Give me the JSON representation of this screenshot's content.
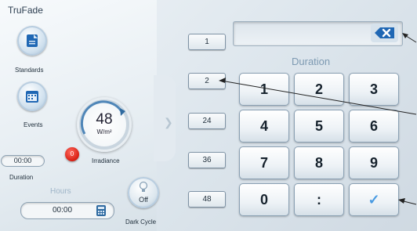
{
  "app": {
    "title": "TruFade"
  },
  "sidebar": {
    "standards_label": "Standards",
    "events_label": "Events"
  },
  "irradiance": {
    "value": "48",
    "unit": "W/m²",
    "label": "Irradiance",
    "alarm_count": "0"
  },
  "duration_mini": {
    "value": "00:00",
    "label": "Duration"
  },
  "hours": {
    "label": "Hours",
    "value": "00:00"
  },
  "dark_cycle": {
    "state": "Off",
    "label": "Dark Cycle"
  },
  "presets": [
    "1",
    "2",
    "24",
    "36",
    "48"
  ],
  "keypad": {
    "title": "Duration",
    "display_value": "",
    "keys": [
      "1",
      "2",
      "3",
      "4",
      "5",
      "6",
      "7",
      "8",
      "9",
      "0",
      ":",
      "✓"
    ]
  },
  "icons": {
    "standards": "document-icon",
    "events": "calendar-icon",
    "dark_cycle": "lightbulb-icon",
    "hours": "calculator-icon",
    "backspace": "backspace-icon",
    "next": "chevron-right-icon"
  },
  "colors": {
    "accent": "#4a9be2",
    "alarm": "#d81e12",
    "label_blue": "#7d9ab2"
  }
}
